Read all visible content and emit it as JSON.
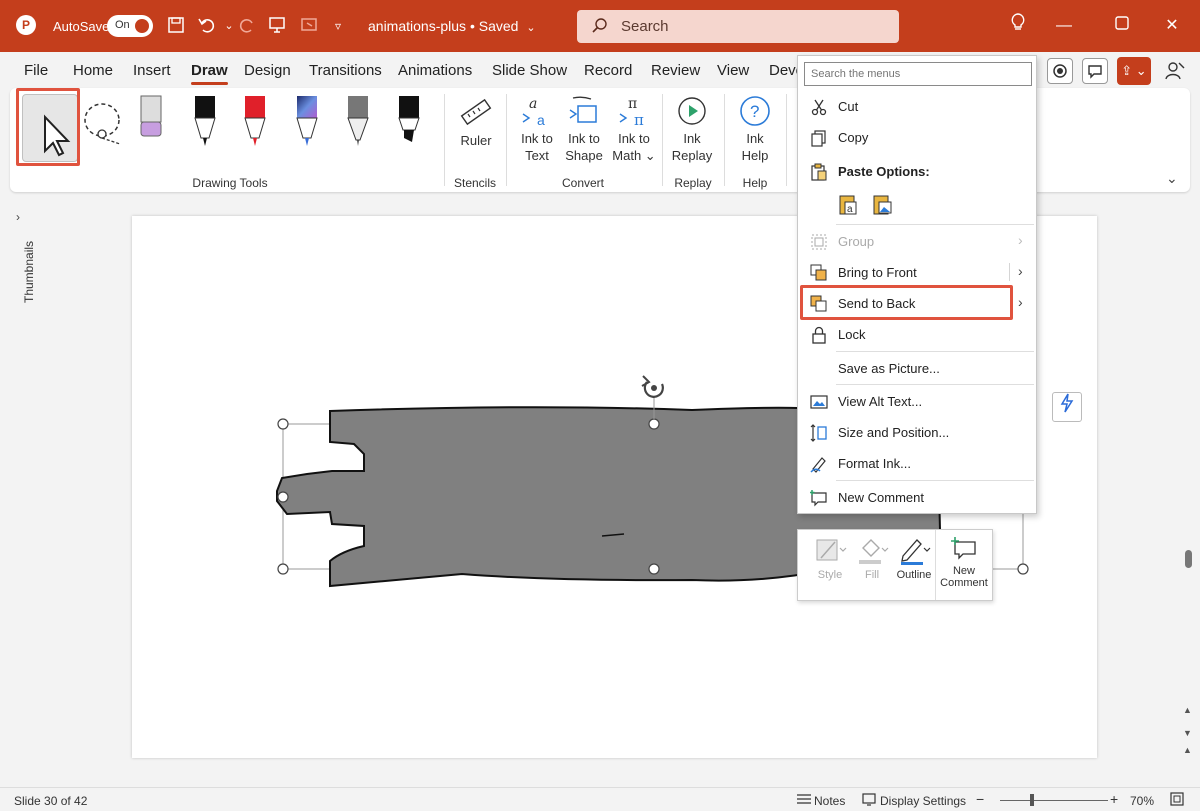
{
  "titlebar": {
    "autosave_label": "AutoSave",
    "autosave_state": "On",
    "doc_title": "animations-plus • Saved",
    "search_placeholder": "Search",
    "accent": "#c43e1c"
  },
  "tabs": [
    "File",
    "Home",
    "Insert",
    "Draw",
    "Design",
    "Transitions",
    "Animations",
    "Slide Show",
    "Record",
    "Review",
    "View",
    "Deve"
  ],
  "active_tab": "Draw",
  "ribbon": {
    "groups": {
      "drawing_tools": "Drawing Tools",
      "stencils": "Stencils",
      "convert": "Convert",
      "replay": "Replay",
      "help": "Help"
    },
    "ruler": "Ruler",
    "ink_to_text_1": "Ink to",
    "ink_to_text_2": "Text",
    "ink_to_shape_1": "Ink to",
    "ink_to_shape_2": "Shape",
    "ink_to_math_1": "Ink to",
    "ink_to_math_2": "Math ⌄",
    "ink_replay_1": "Ink",
    "ink_replay_2": "Replay",
    "ink_help_1": "Ink",
    "ink_help_2": "Help",
    "pens": [
      {
        "name": "eraser",
        "color": "#b47ad6"
      },
      {
        "name": "pen-black",
        "color": "#111111"
      },
      {
        "name": "pen-red",
        "color": "#e0202a"
      },
      {
        "name": "pen-galaxy",
        "color": "#3a6ed8"
      },
      {
        "name": "pencil-gray",
        "color": "#777777"
      },
      {
        "name": "highlighter-black",
        "color": "#111111"
      }
    ]
  },
  "left_rail": {
    "thumbnails_label": "Thumbnails"
  },
  "context_menu": {
    "search_placeholder": "Search the menus",
    "items": {
      "cut": "Cut",
      "copy": "Copy",
      "paste_options": "Paste Options:",
      "group": "Group",
      "bring_to_front": "Bring to Front",
      "send_to_back": "Send to Back",
      "lock": "Lock",
      "save_as_picture": "Save as Picture...",
      "view_alt_text": "View Alt Text...",
      "size_and_position": "Size and Position...",
      "format_ink": "Format Ink...",
      "new_comment": "New Comment"
    }
  },
  "mini_toolbar": {
    "style": "Style",
    "fill": "Fill",
    "outline": "Outline",
    "new_comment_1": "New",
    "new_comment_2": "Comment"
  },
  "status_bar": {
    "slide_info": "Slide 30 of 42",
    "notes": "Notes",
    "display_settings": "Display Settings",
    "zoom_minus": "−",
    "zoom_plus": "+",
    "zoom_level": "70%"
  },
  "colors": {
    "highlight_outline": "#e0533e",
    "shape_fill": "#808080"
  }
}
